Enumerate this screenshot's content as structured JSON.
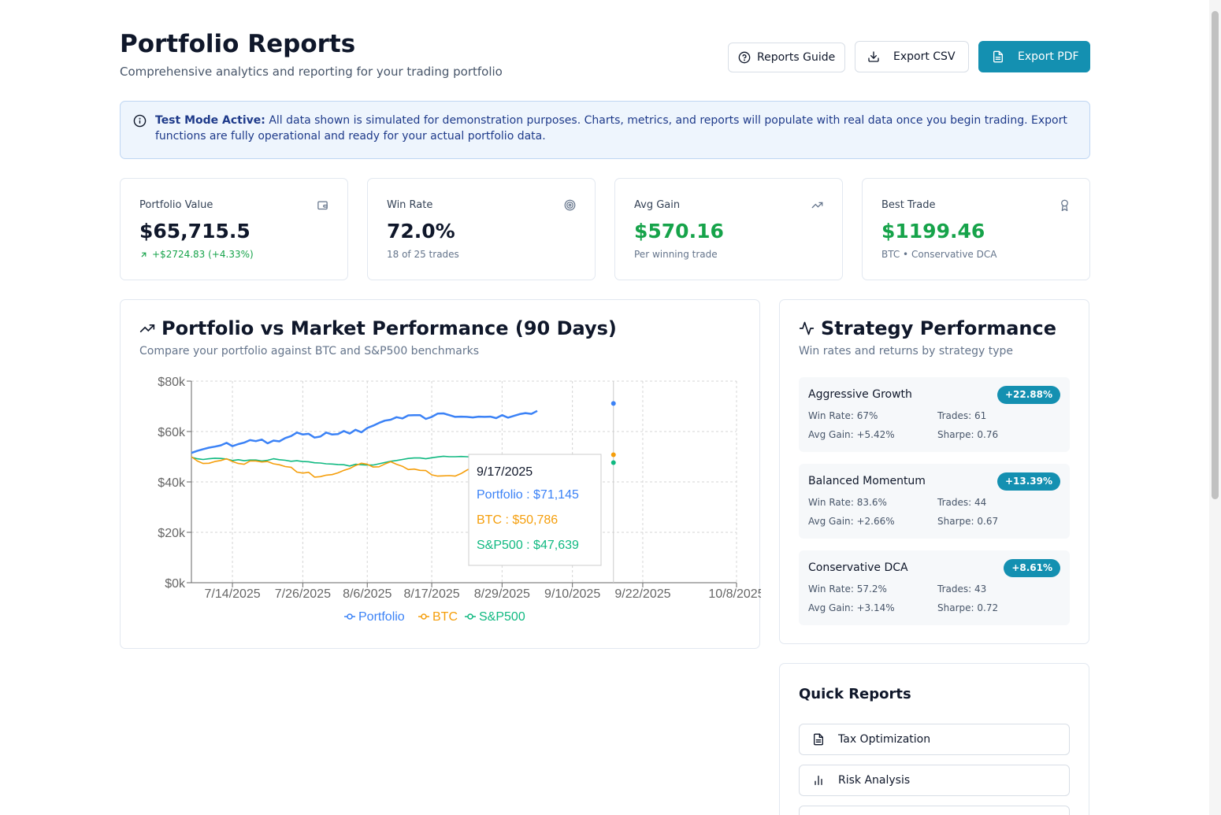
{
  "header": {
    "title": "Portfolio Reports",
    "subtitle": "Comprehensive analytics and reporting for your trading portfolio",
    "buttons": {
      "guide": "Reports Guide",
      "csv": "Export CSV",
      "pdf": "Export PDF"
    }
  },
  "alert": {
    "bold": "Test Mode Active:",
    "text": " All data shown is simulated for demonstration purposes. Charts, metrics, and reports will populate with real data once you begin trading. Export functions are fully operational and ready for your actual portfolio data."
  },
  "stats": [
    {
      "label": "Portfolio Value",
      "value": "$65,715.5",
      "sub": "+$2724.83 (+4.33%)",
      "icon": "wallet-icon"
    },
    {
      "label": "Win Rate",
      "value": "72.0%",
      "sub": "18 of 25 trades",
      "icon": "target-icon"
    },
    {
      "label": "Avg Gain",
      "value": "$570.16",
      "sub": "Per winning trade",
      "icon": "trending-up-icon"
    },
    {
      "label": "Best Trade",
      "value": "$1199.46",
      "sub": "BTC • Conservative DCA",
      "icon": "award-icon"
    }
  ],
  "colors": {
    "accent": "#1490b1",
    "positive": "#16a34a",
    "portfolio": "#3b82f6",
    "btc": "#f59e0b",
    "sp500": "#10b981"
  },
  "performance": {
    "title": "Portfolio vs Market Performance (90 Days)",
    "subtitle": "Compare your portfolio against BTC and S&P500 benchmarks"
  },
  "chart_data": {
    "type": "line",
    "y_ticks": [
      "$0k",
      "$20k",
      "$40k",
      "$60k",
      "$80k"
    ],
    "x_ticks": [
      "7/14/2025",
      "7/26/2025",
      "8/6/2025",
      "8/17/2025",
      "8/29/2025",
      "9/10/2025",
      "9/22/2025",
      "10/8/2025"
    ],
    "x_range": [
      "2025-07-07",
      "2025-10-08"
    ],
    "ylim": [
      0,
      80000
    ],
    "grid": true,
    "legend_position": "bottom",
    "x_dates": [
      "2025-07-07",
      "2025-07-08",
      "2025-07-09",
      "2025-07-10",
      "2025-07-11",
      "2025-07-12",
      "2025-07-13",
      "2025-07-14",
      "2025-07-15",
      "2025-07-16",
      "2025-07-17",
      "2025-07-18",
      "2025-07-19",
      "2025-07-20",
      "2025-07-21",
      "2025-07-22",
      "2025-07-23",
      "2025-07-24",
      "2025-07-25",
      "2025-07-26",
      "2025-07-27",
      "2025-07-28",
      "2025-07-29",
      "2025-07-30",
      "2025-07-31",
      "2025-08-01",
      "2025-08-02",
      "2025-08-03",
      "2025-08-04",
      "2025-08-05",
      "2025-08-06",
      "2025-08-07",
      "2025-08-08",
      "2025-08-09",
      "2025-08-10",
      "2025-08-11",
      "2025-08-12",
      "2025-08-13",
      "2025-08-14",
      "2025-08-15",
      "2025-08-16",
      "2025-08-17",
      "2025-08-18",
      "2025-08-19",
      "2025-08-20",
      "2025-08-21",
      "2025-08-22",
      "2025-08-23",
      "2025-08-24",
      "2025-08-25",
      "2025-08-26",
      "2025-08-27",
      "2025-08-28",
      "2025-08-29",
      "2025-08-30",
      "2025-08-31",
      "2025-09-01",
      "2025-09-02",
      "2025-09-03",
      "2025-09-04"
    ],
    "series": [
      {
        "name": "Portfolio",
        "values": [
          51500,
          52300,
          53000,
          53600,
          54000,
          54500,
          55500,
          54200,
          55000,
          55600,
          56600,
          56200,
          56800,
          55300,
          56400,
          56100,
          57400,
          58200,
          59600,
          58800,
          59100,
          57600,
          58000,
          59600,
          58800,
          59000,
          60200,
          59200,
          60700,
          59700,
          61400,
          62300,
          63400,
          64300,
          64700,
          65700,
          65200,
          66400,
          66500,
          66500,
          65000,
          65800,
          67100,
          67200,
          66500,
          65800,
          65900,
          65800,
          65600,
          65900,
          65800,
          65900,
          65300,
          66500,
          65500,
          66200,
          66900,
          67300,
          67000,
          68200
        ]
      },
      {
        "name": "BTC",
        "values": [
          50000,
          48300,
          47300,
          47400,
          48100,
          48500,
          49200,
          48100,
          47300,
          47000,
          48300,
          48300,
          47900,
          48100,
          47200,
          46800,
          46100,
          45800,
          43900,
          43500,
          43800,
          41900,
          42100,
          42700,
          42900,
          43600,
          44600,
          45300,
          46500,
          47400,
          47000,
          45900,
          46000,
          47100,
          48000,
          47000,
          46200,
          44900,
          45100,
          44600,
          44500,
          42800,
          42300,
          42400,
          42500,
          42300,
          43300,
          44700,
          45800,
          47000,
          47500,
          47800,
          48000,
          48600,
          48100,
          48500,
          48300,
          48200,
          48100,
          48000
        ]
      },
      {
        "name": "S&P500",
        "values": [
          49800,
          49200,
          48900,
          49200,
          49400,
          49300,
          49100,
          48500,
          48800,
          48400,
          48700,
          48700,
          48300,
          48600,
          49200,
          48800,
          48600,
          48200,
          48400,
          48100,
          48000,
          47600,
          47500,
          47200,
          47100,
          46900,
          46800,
          46300,
          47000,
          46800,
          46700,
          46700,
          47200,
          47700,
          48200,
          48500,
          48900,
          49300,
          49500,
          49500,
          49200,
          49600,
          49900,
          50200,
          50000,
          50000,
          50100,
          50000,
          49800,
          49700,
          49900,
          49800,
          49700,
          49600,
          49500,
          49700,
          49800,
          49900,
          50000,
          50100
        ]
      }
    ],
    "hover": {
      "date": "9/17/2025",
      "x_date": "2025-09-17",
      "portfolio": 71145,
      "btc": 50786,
      "sp500": 47639
    }
  },
  "tooltip": {
    "date": "9/17/2025",
    "portfolio": "Portfolio : $71,145",
    "btc": "BTC : $50,786",
    "sp500": "S&P500 : $47,639"
  },
  "legend": {
    "portfolio": "Portfolio",
    "btc": "BTC",
    "sp500": "S&P500"
  },
  "strategy": {
    "title": "Strategy Performance",
    "subtitle": "Win rates and returns by strategy type",
    "items": [
      {
        "name": "Aggressive Growth",
        "badge": "+22.88%",
        "win_rate": "Win Rate: 67%",
        "trades": "Trades: 61",
        "avg_gain": "Avg Gain: +5.42%",
        "sharpe": "Sharpe: 0.76"
      },
      {
        "name": "Balanced Momentum",
        "badge": "+13.39%",
        "win_rate": "Win Rate: 83.6%",
        "trades": "Trades: 44",
        "avg_gain": "Avg Gain: +2.66%",
        "sharpe": "Sharpe: 0.67"
      },
      {
        "name": "Conservative DCA",
        "badge": "+8.61%",
        "win_rate": "Win Rate: 57.2%",
        "trades": "Trades: 43",
        "avg_gain": "Avg Gain: +3.14%",
        "sharpe": "Sharpe: 0.72"
      }
    ]
  },
  "quick_reports": {
    "title": "Quick Reports",
    "items": [
      {
        "label": "Tax Optimization",
        "icon": "file-text-icon"
      },
      {
        "label": "Risk Analysis",
        "icon": "bar-chart-icon"
      }
    ]
  }
}
